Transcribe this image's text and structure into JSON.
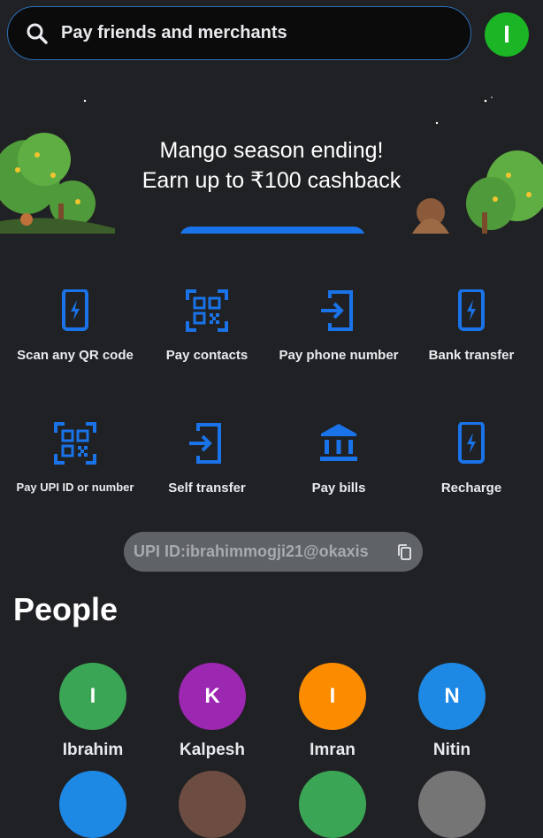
{
  "search": {
    "placeholder": "Pay friends and merchants"
  },
  "profile": {
    "initial": "I",
    "color": "#1bb525"
  },
  "banner": {
    "line1": "Mango season ending!",
    "line2": "Earn up to ₹100 cashback"
  },
  "actions": [
    {
      "label": "Scan any QR code",
      "icon": "phone-bolt-icon"
    },
    {
      "label": "Pay contacts",
      "icon": "qr-code-icon"
    },
    {
      "label": "Pay phone number",
      "icon": "phone-arrow-icon"
    },
    {
      "label": "Bank transfer",
      "icon": "phone-bolt-icon"
    },
    {
      "label": "Pay UPI ID or number",
      "icon": "qr-code-icon"
    },
    {
      "label": "Self transfer",
      "icon": "phone-arrow-icon"
    },
    {
      "label": "Pay bills",
      "icon": "bank-icon"
    },
    {
      "label": "Recharge",
      "icon": "phone-bolt-icon"
    }
  ],
  "upi": {
    "text": "UPI ID:ibrahimmogji21@okaxis",
    "icon": "copy-icon"
  },
  "people": {
    "title": "People",
    "items": [
      {
        "initial": "I",
        "name": "Ibrahim",
        "color": "#3aa655"
      },
      {
        "initial": "K",
        "name": "Kalpesh",
        "color": "#9c27b0"
      },
      {
        "initial": "I",
        "name": "Imran",
        "color": "#fb8c00"
      },
      {
        "initial": "N",
        "name": "Nitin",
        "color": "#1e88e5"
      }
    ],
    "more_colors": [
      "#1e88e5",
      "#6d4c41",
      "#3aa655",
      "#757575"
    ]
  },
  "colors": {
    "accent": "#1a73e8",
    "icon_blue": "#1a73e8",
    "background": "#202124"
  }
}
